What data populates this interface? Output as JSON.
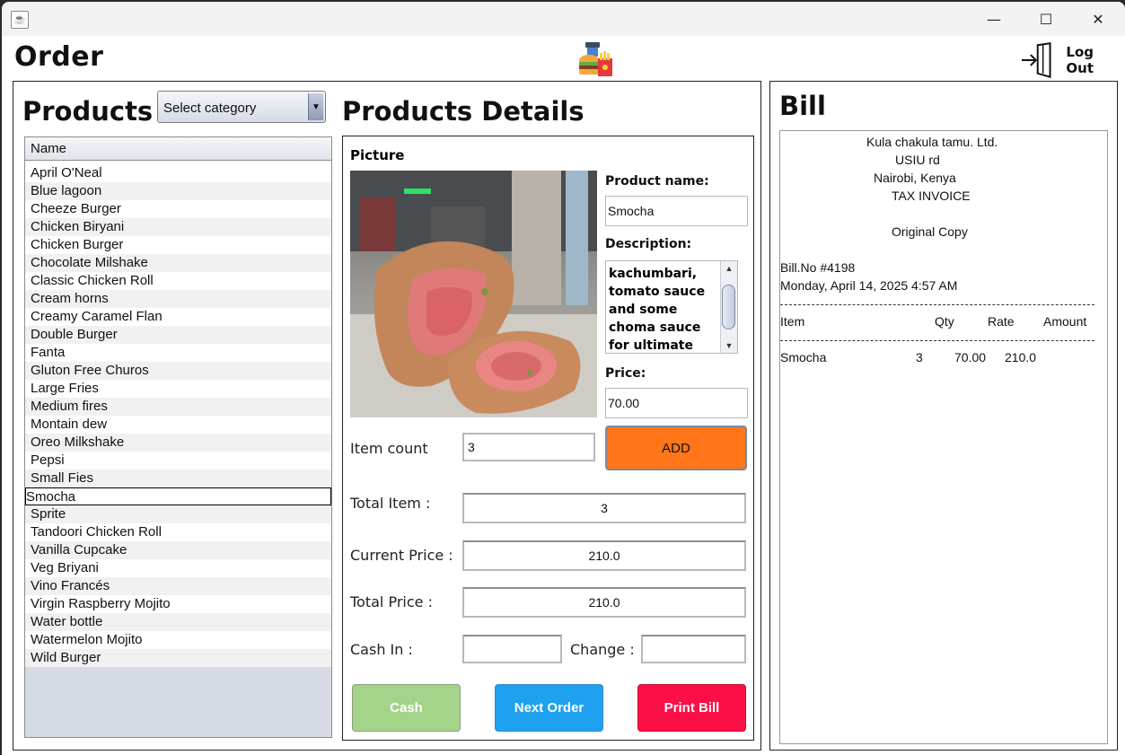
{
  "window": {
    "app_icon": "java-cup-icon",
    "minimize": "—",
    "maximize": "☐",
    "close": "✕"
  },
  "header": {
    "title": "Order",
    "logo_icon": "fast-food-icon",
    "logout_label": "Log Out",
    "logout_icon": "logout-door-icon"
  },
  "products": {
    "title": "Products",
    "category_select": "Select category",
    "column_header": "Name",
    "items": [
      "April O'Neal",
      "Blue lagoon",
      "Cheeze Burger",
      "Chicken Biryani",
      "Chicken Burger",
      "Chocolate Milshake",
      "Classic Chicken Roll",
      "Cream horns",
      "Creamy Caramel Flan",
      "Double Burger",
      "Fanta",
      "Gluton Free Churos",
      "Large Fries",
      "Medium fires",
      "Montain dew",
      "Oreo Milkshake",
      "Pepsi",
      "Small Fies",
      "Smocha",
      "Sprite",
      "Tandoori Chicken Roll",
      "Vanilla Cupcake",
      "Veg Briyani",
      "Vino Francés",
      "Virgin Raspberry Mojito",
      "Water bottle",
      "Watermelon Mojito",
      "Wild Burger"
    ],
    "selected": "Smocha"
  },
  "details": {
    "title": "Products Details",
    "picture_label": "Picture",
    "name_label": "Product name:",
    "name_value": "Smocha",
    "desc_label": "Description:",
    "desc_value": "kachumbari, tomato sauce and some choma sauce for ultimate sweet",
    "price_label": "Price:",
    "price_value": "70.00",
    "item_count_label": "Item count",
    "item_count_value": "3",
    "add_button": "ADD",
    "total_item_label": "Total Item :",
    "total_item_value": "3",
    "current_price_label": "Current Price :",
    "current_price_value": "210.0",
    "total_price_label": "Total Price :",
    "total_price_value": "210.0",
    "cash_in_label": "Cash In :",
    "cash_in_value": "",
    "change_label": "Change :",
    "change_value": "",
    "cash_button": "Cash",
    "next_order_button": "Next Order",
    "print_bill_button": "Print Bill"
  },
  "bill": {
    "title": "Bill",
    "company": "Kula chakula tamu. Ltd.",
    "street": "USIU rd",
    "city": "Nairobi, Kenya",
    "invoice_type": "TAX INVOICE",
    "copy": "Original Copy",
    "bill_no": "Bill.No #4198",
    "date": "Monday, April 14, 2025 4:57 AM",
    "col_item": "Item",
    "col_qty": "Qty",
    "col_rate": "Rate",
    "col_amount": "Amount",
    "rows": [
      {
        "item": "Smocha",
        "qty": "3",
        "rate": "70.00",
        "amount": "210.0"
      }
    ]
  },
  "colors": {
    "add_button": "#ff7517",
    "cash_button": "#a3d48a",
    "next_order_button": "#1ea1ef",
    "print_bill_button": "#fb0f46"
  }
}
